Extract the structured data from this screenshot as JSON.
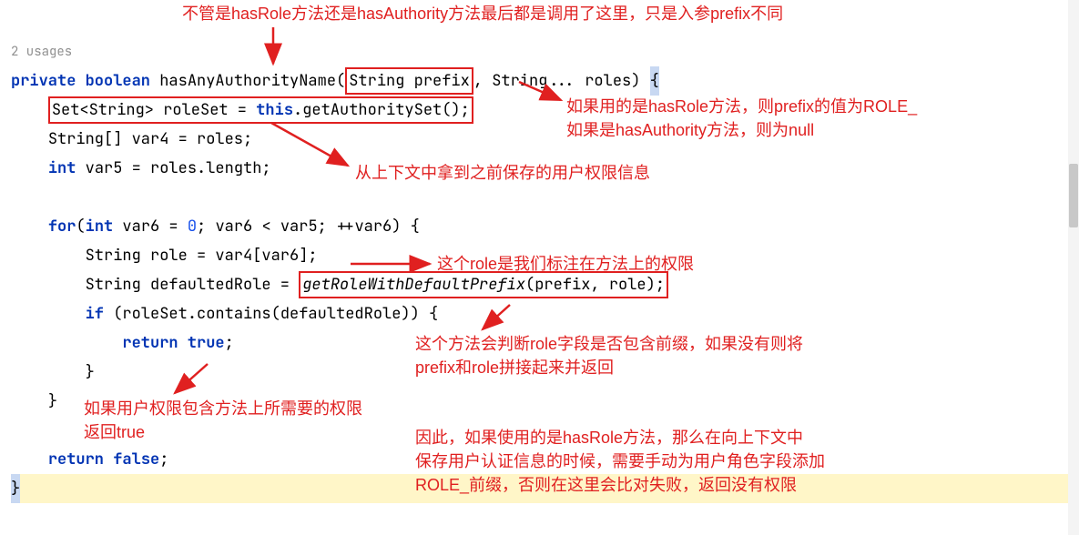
{
  "usages_text": "2 usages",
  "code": {
    "l1_private": "private",
    "l1_boolean": "boolean",
    "l1_method": " hasAnyAuthorityName(",
    "l1_param1": "String prefix",
    "l1_mid": ", String... roles) ",
    "l1_brace": "{",
    "l2_line": "Set<String> roleSet = ",
    "l2_this": "this",
    "l2_call": ".getAuthoritySet();",
    "l3_line": "String[] var4 = roles;",
    "l4_int": "int",
    "l4_line": " var5 = roles.length;",
    "l5_for": "for",
    "l5_open": "(",
    "l5_int": "int",
    "l5_a": " var6 = ",
    "l5_zero": "0",
    "l5_b": "; var6 < var5; ++var6) {",
    "l6_line": "String role = var4[var6];",
    "l7_a": "String defaultedRole = ",
    "l7_call": "getRoleWithDefaultPrefix",
    "l7_b": "(prefix, role);",
    "l8_if": "if",
    "l8_line": " (roleSet.contains(defaultedRole)) {",
    "l9_return": "return",
    "l9_true": "true",
    "l9_semi": ";",
    "l10_brace": "}",
    "l11_brace": "}",
    "l12_return": "return",
    "l12_false": "false",
    "l12_semi": ";",
    "l13_brace": "}"
  },
  "annotations": {
    "top": "不管是hasRole方法还是hasAuthority方法最后都是调用了这里，只是入参prefix不同",
    "right1": "如果用的是hasRole方法，则prefix的值为ROLE_\n如果是hasAuthority方法，则为null",
    "mid1": "从上下文中拿到之前保存的用户权限信息",
    "mid2": "这个role是我们标注在方法上的权限",
    "right2": "这个方法会判断role字段是否包含前缀，如果没有则将\nprefix和role拼接起来并返回",
    "left1": "如果用户权限包含方法上所需要的权限\n返回true",
    "right3": "因此，如果使用的是hasRole方法，那么在向上下文中\n保存用户认证信息的时候，需要手动为用户角色字段添加\nROLE_前缀，否则在这里会比对失败，返回没有权限"
  }
}
